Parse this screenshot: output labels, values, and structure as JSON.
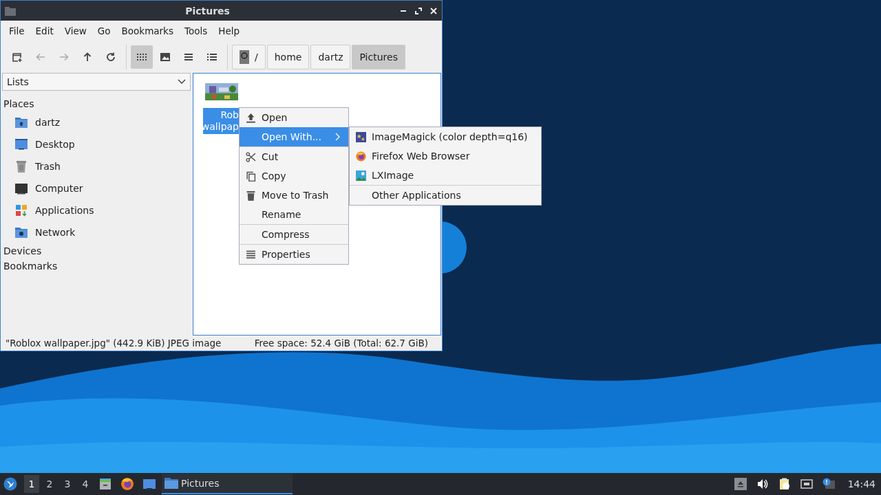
{
  "window": {
    "title": "Pictures"
  },
  "menubar": [
    "File",
    "Edit",
    "View",
    "Go",
    "Bookmarks",
    "Tools",
    "Help"
  ],
  "toolbar": {
    "nav": [
      {
        "kind": "new-window",
        "disabled": false
      },
      {
        "kind": "back",
        "disabled": true
      },
      {
        "kind": "forward",
        "disabled": true
      },
      {
        "kind": "up",
        "disabled": false
      },
      {
        "kind": "reload",
        "disabled": false
      }
    ],
    "views": [
      {
        "kind": "icons",
        "selected": true
      },
      {
        "kind": "thumbnails",
        "selected": false
      },
      {
        "kind": "compact",
        "selected": false
      },
      {
        "kind": "details",
        "selected": false
      }
    ]
  },
  "path": [
    {
      "label": "/",
      "kind": "root",
      "selected": false
    },
    {
      "label": "home",
      "kind": "dir",
      "selected": false
    },
    {
      "label": "dartz",
      "kind": "dir",
      "selected": false
    },
    {
      "label": "Pictures",
      "kind": "dir",
      "selected": true
    }
  ],
  "sidebar": {
    "dropdown": "Lists",
    "sections": [
      {
        "label": "Places",
        "children": [
          {
            "label": "dartz",
            "kind": "home"
          },
          {
            "label": "Desktop",
            "kind": "desktop"
          },
          {
            "label": "Trash",
            "kind": "trash"
          },
          {
            "label": "Computer",
            "kind": "computer"
          },
          {
            "label": "Applications",
            "kind": "applications"
          },
          {
            "label": "Network",
            "kind": "network"
          }
        ]
      },
      {
        "label": "Devices"
      },
      {
        "label": "Bookmarks"
      }
    ]
  },
  "files": [
    {
      "kind": "picture",
      "label_lines": [
        "Rob",
        "wallpap"
      ],
      "selected": true
    }
  ],
  "context_menu": {
    "groups": [
      [
        {
          "label": "Open",
          "kind": "open",
          "selected": false,
          "submenu": false
        },
        {
          "label": "Open With...",
          "kind": "none",
          "selected": true,
          "submenu": true
        }
      ],
      [
        {
          "label": "Cut",
          "kind": "cut",
          "selected": false,
          "submenu": false
        },
        {
          "label": "Copy",
          "kind": "copy",
          "selected": false,
          "submenu": false
        },
        {
          "label": "Move to Trash",
          "kind": "trash",
          "selected": false,
          "submenu": false
        },
        {
          "label": "Rename",
          "kind": "none",
          "selected": false,
          "submenu": false
        }
      ],
      [
        {
          "label": "Compress",
          "kind": "none",
          "selected": false,
          "submenu": false
        }
      ],
      [
        {
          "label": "Properties",
          "kind": "properties",
          "selected": false,
          "submenu": false
        }
      ]
    ]
  },
  "submenu": {
    "groups": [
      [
        {
          "label": "ImageMagick (color depth=q16)",
          "kind": "imagemagick"
        },
        {
          "label": "Firefox Web Browser",
          "kind": "firefox"
        },
        {
          "label": "LXImage",
          "kind": "lximage"
        }
      ],
      [
        {
          "label": "Other Applications",
          "kind": "none"
        }
      ]
    ]
  },
  "status_bar": {
    "left": "\"Roblox wallpaper.jpg\" (442.9 KiB) JPEG image",
    "right": "Free space: 52.4 GiB (Total: 62.7 GiB)"
  },
  "taskbar": {
    "workspaces": [
      {
        "label": "1",
        "selected": true
      },
      {
        "label": "2",
        "selected": false
      },
      {
        "label": "3",
        "selected": false
      },
      {
        "label": "4",
        "selected": false
      }
    ],
    "launchers": [
      {
        "kind": "file-manager"
      },
      {
        "kind": "firefox"
      },
      {
        "kind": "desktop"
      }
    ],
    "tasks": [
      {
        "label": "Pictures",
        "selected": true
      }
    ],
    "tray": [
      {
        "kind": "eject"
      },
      {
        "kind": "volume"
      },
      {
        "kind": "clipboard"
      },
      {
        "kind": "network"
      },
      {
        "kind": "notification"
      }
    ],
    "clock": "14:44"
  }
}
